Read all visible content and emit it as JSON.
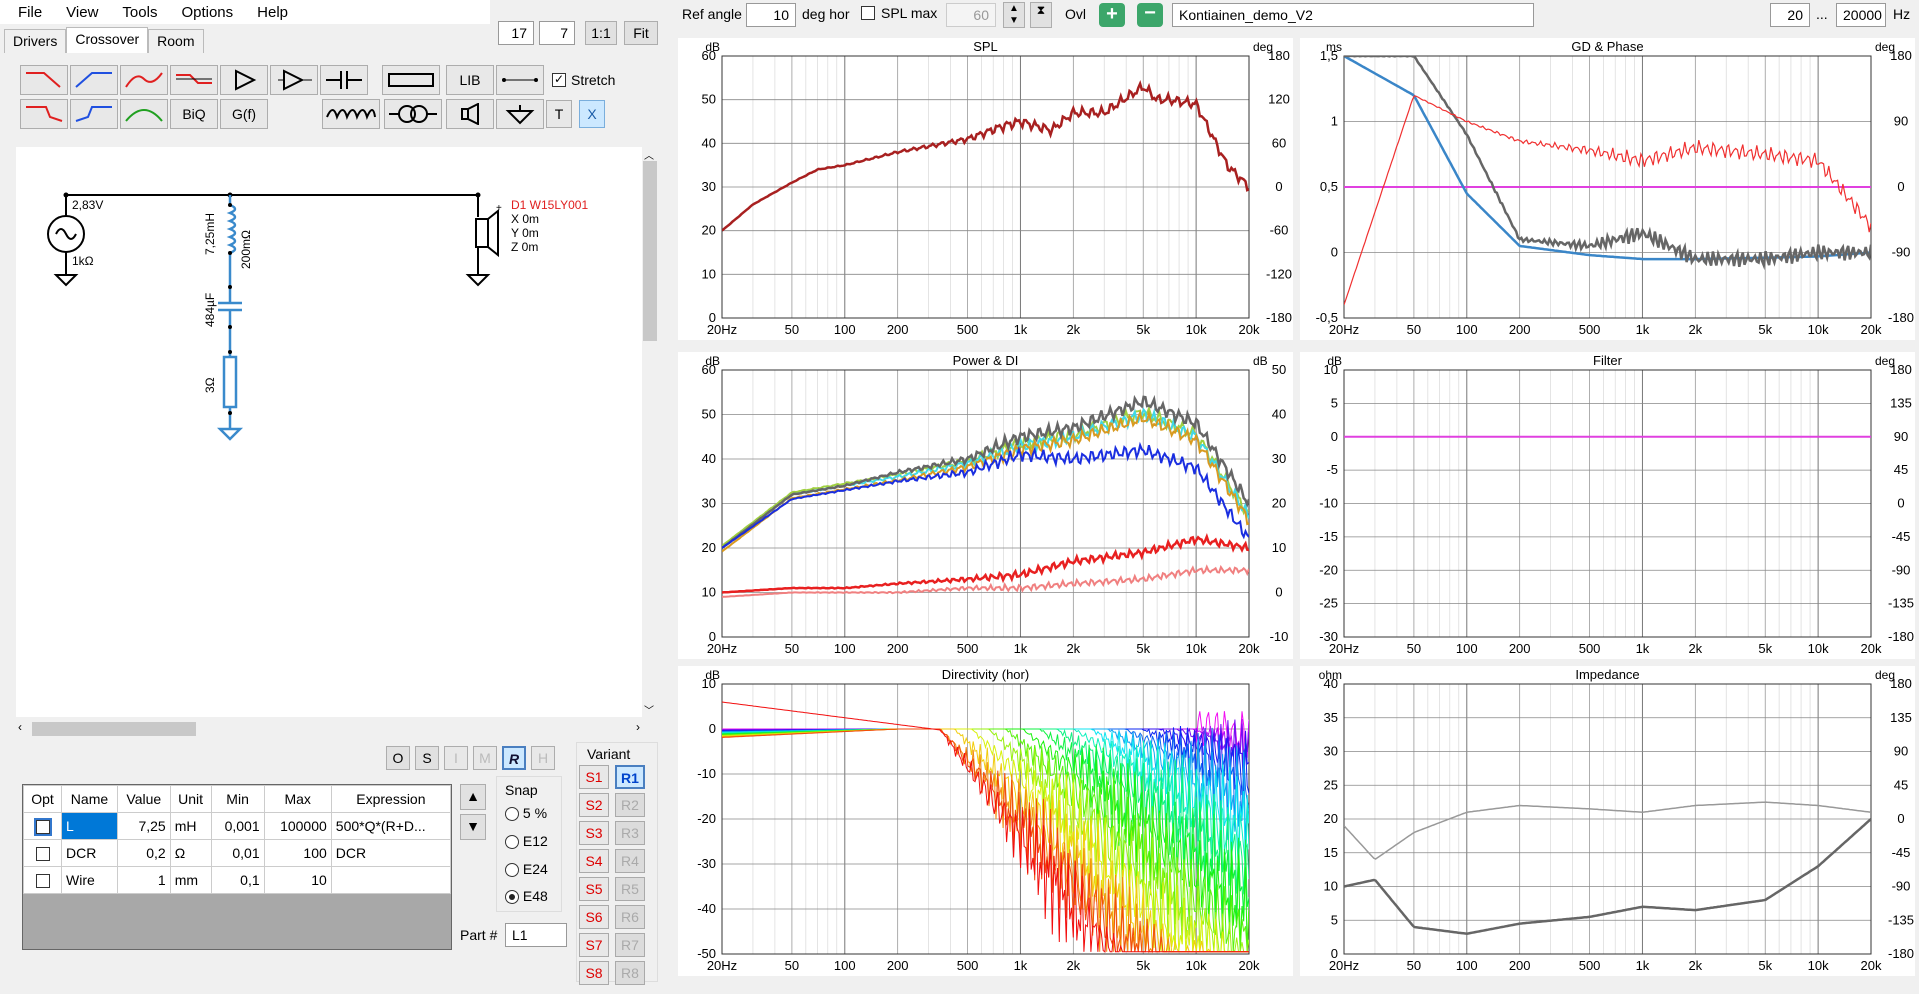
{
  "menu": [
    "File",
    "View",
    "Tools",
    "Options",
    "Help"
  ],
  "tabs": [
    "Drivers",
    "Crossover",
    "Room"
  ],
  "zoom": {
    "a": "17",
    "b": "7",
    "one": "1:1",
    "fit": "Fit"
  },
  "toolbar": {
    "ref_angle_label": "Ref angle",
    "ref_angle": "10",
    "deg_hor": "deg hor",
    "splmax_label": "SPL max",
    "splmax": "60",
    "ovl": "Ovl",
    "project": "Kontiainen_demo_V2",
    "fmin": "20",
    "dots": "...",
    "fmax": "20000",
    "hz": "Hz"
  },
  "parts": {
    "lib": "LIB",
    "stretch": "Stretch",
    "biq": "BiQ",
    "gf": "G(f)",
    "t": "T",
    "x": "X"
  },
  "schematic": {
    "source_v": "2,83V",
    "source_r": "1kΩ",
    "inductor": "7,25mH",
    "dcr": "200mΩ",
    "cap": "484µF",
    "res": "3Ω",
    "driver": "D1 W15LY001",
    "x": "X 0m",
    "y": "Y 0m",
    "z": "Z 0m"
  },
  "modes": [
    "O",
    "S",
    "I",
    "M",
    "R",
    "H"
  ],
  "table": {
    "headers": [
      "Opt",
      "Name",
      "Value",
      "Unit",
      "Min",
      "Max",
      "Expression"
    ],
    "rows": [
      [
        "",
        "L",
        "7,25",
        "mH",
        "0,001",
        "100000",
        "500*Q*(R+D..."
      ],
      [
        "",
        "DCR",
        "0,2",
        "Ω",
        "0,01",
        "100",
        "DCR"
      ],
      [
        "",
        "Wire",
        "1",
        "mm",
        "0,1",
        "10",
        ""
      ]
    ]
  },
  "snap": {
    "title": "Snap",
    "opts": [
      "5 %",
      "E12",
      "E24",
      "E48"
    ]
  },
  "part": {
    "label": "Part #",
    "value": "L1"
  },
  "variant": {
    "title": "Variant",
    "s": [
      "S1",
      "S2",
      "S3",
      "S4",
      "S5",
      "S6",
      "S7",
      "S8"
    ],
    "r": [
      "R1",
      "R2",
      "R3",
      "R4",
      "R5",
      "R6",
      "R7",
      "R8"
    ]
  },
  "xticks": [
    "20Hz",
    "50",
    "100",
    "200",
    "500",
    "1k",
    "2k",
    "5k",
    "10k",
    "20k"
  ],
  "charts": {
    "spl": {
      "title": "SPL",
      "lunit": "dB",
      "runit": "deg",
      "left": [
        "60",
        "50",
        "40",
        "30",
        "20",
        "10",
        "0"
      ],
      "right": [
        "180",
        "120",
        "60",
        "0",
        "-60",
        "-120",
        "-180"
      ]
    },
    "gd": {
      "title": "GD & Phase",
      "lunit": "ms",
      "runit": "deg",
      "left": [
        "1,5",
        "1",
        "0,5",
        "0",
        "-0,5"
      ],
      "right": [
        "180",
        "90",
        "0",
        "-90",
        "-180"
      ]
    },
    "power": {
      "title": "Power & DI",
      "lunit": "dB",
      "runit": "dB",
      "left": [
        "60",
        "50",
        "40",
        "30",
        "20",
        "10",
        "0"
      ],
      "right": [
        "50",
        "40",
        "30",
        "20",
        "10",
        "0",
        "-10"
      ]
    },
    "filter": {
      "title": "Filter",
      "lunit": "dB",
      "runit": "deg",
      "left": [
        "10",
        "5",
        "0",
        "-5",
        "-10",
        "-15",
        "-20",
        "-25",
        "-30"
      ],
      "right": [
        "180",
        "135",
        "90",
        "45",
        "0",
        "-45",
        "-90",
        "-135",
        "-180"
      ]
    },
    "dir": {
      "title": "Directivity (hor)",
      "lunit": "dB",
      "runit": "",
      "left": [
        "10",
        "0",
        "-10",
        "-20",
        "-30",
        "-40",
        "-50"
      ],
      "right": []
    },
    "imp": {
      "title": "Impedance",
      "lunit": "ohm",
      "runit": "deg",
      "left": [
        "40",
        "35",
        "30",
        "25",
        "20",
        "15",
        "10",
        "5",
        "0"
      ],
      "right": [
        "180",
        "135",
        "90",
        "45",
        "0",
        "-45",
        "-90",
        "-135",
        "-180"
      ]
    }
  },
  "chart_data": [
    {
      "type": "line",
      "title": "SPL",
      "ylabel": "dB",
      "ylim": [
        0,
        60
      ],
      "x": [
        20,
        30,
        50,
        70,
        100,
        200,
        500,
        800,
        1000,
        1500,
        2000,
        3000,
        5000,
        6000,
        7000,
        10000,
        15000,
        20000
      ],
      "series": [
        {
          "values": [
            20,
            26,
            31,
            34,
            35,
            38,
            41,
            44,
            45,
            43,
            47,
            47,
            53,
            50,
            50,
            49,
            35,
            30
          ]
        }
      ],
      "color": "#a82020"
    },
    {
      "type": "line",
      "title": "GD & Phase",
      "ylabel": "ms",
      "ylim": [
        -0.5,
        1.5
      ],
      "x": [
        20,
        50,
        100,
        200,
        500,
        1000,
        2000,
        5000,
        10000,
        20000
      ],
      "series": [
        {
          "values": [
            1.5,
            1.2,
            0.45,
            0.05,
            -0.02,
            -0.05,
            -0.05,
            -0.04,
            -0.03,
            0
          ]
        },
        {
          "values": [
            1.5,
            1.5,
            0.9,
            0.1,
            0.05,
            0.15,
            -0.05,
            -0.05,
            0,
            0
          ]
        },
        {
          "values": [
            -0.4,
            1.2,
            1,
            0.85,
            0.78,
            0.7,
            0.8,
            0.75,
            0.7,
            0.2
          ]
        }
      ]
    },
    {
      "type": "line",
      "title": "Power & DI",
      "ylabel": "dB",
      "ylim": [
        0,
        60
      ],
      "x": [
        20,
        50,
        100,
        200,
        500,
        1000,
        2000,
        5000,
        10000,
        20000
      ],
      "series": [
        {
          "values": [
            20,
            32,
            34,
            37,
            40,
            45,
            47,
            53,
            48,
            30
          ]
        },
        {
          "values": [
            20,
            32,
            34,
            36,
            39,
            43,
            45,
            50,
            45,
            27
          ]
        },
        {
          "values": [
            20,
            31,
            33,
            35,
            37,
            41,
            40,
            42,
            38,
            22
          ]
        },
        {
          "values": [
            10,
            11,
            11,
            12,
            13,
            14,
            17,
            19,
            22,
            20
          ]
        },
        {
          "values": [
            9,
            10,
            10,
            10,
            11,
            11,
            12,
            13,
            15,
            15
          ]
        }
      ]
    },
    {
      "type": "line",
      "title": "Filter",
      "ylabel": "dB",
      "ylim": [
        -30,
        10
      ],
      "x": [
        20,
        20000
      ],
      "series": [
        {
          "values": [
            0,
            0
          ]
        }
      ]
    },
    {
      "type": "line",
      "title": "Directivity (hor)",
      "ylabel": "dB",
      "ylim": [
        -50,
        10
      ],
      "x": [
        20,
        20000
      ]
    },
    {
      "type": "line",
      "title": "Impedance",
      "ylabel": "ohm",
      "ylim": [
        0,
        40
      ],
      "x": [
        20,
        30,
        50,
        100,
        200,
        500,
        1000,
        2000,
        5000,
        10000,
        20000
      ],
      "series": [
        {
          "values": [
            10,
            11,
            4,
            3,
            4.5,
            5.5,
            7,
            6.5,
            8,
            13,
            20
          ]
        },
        {
          "values": [
            19,
            14,
            18,
            21,
            22,
            21.5,
            21,
            22,
            22.5,
            22,
            21
          ]
        }
      ]
    }
  ]
}
